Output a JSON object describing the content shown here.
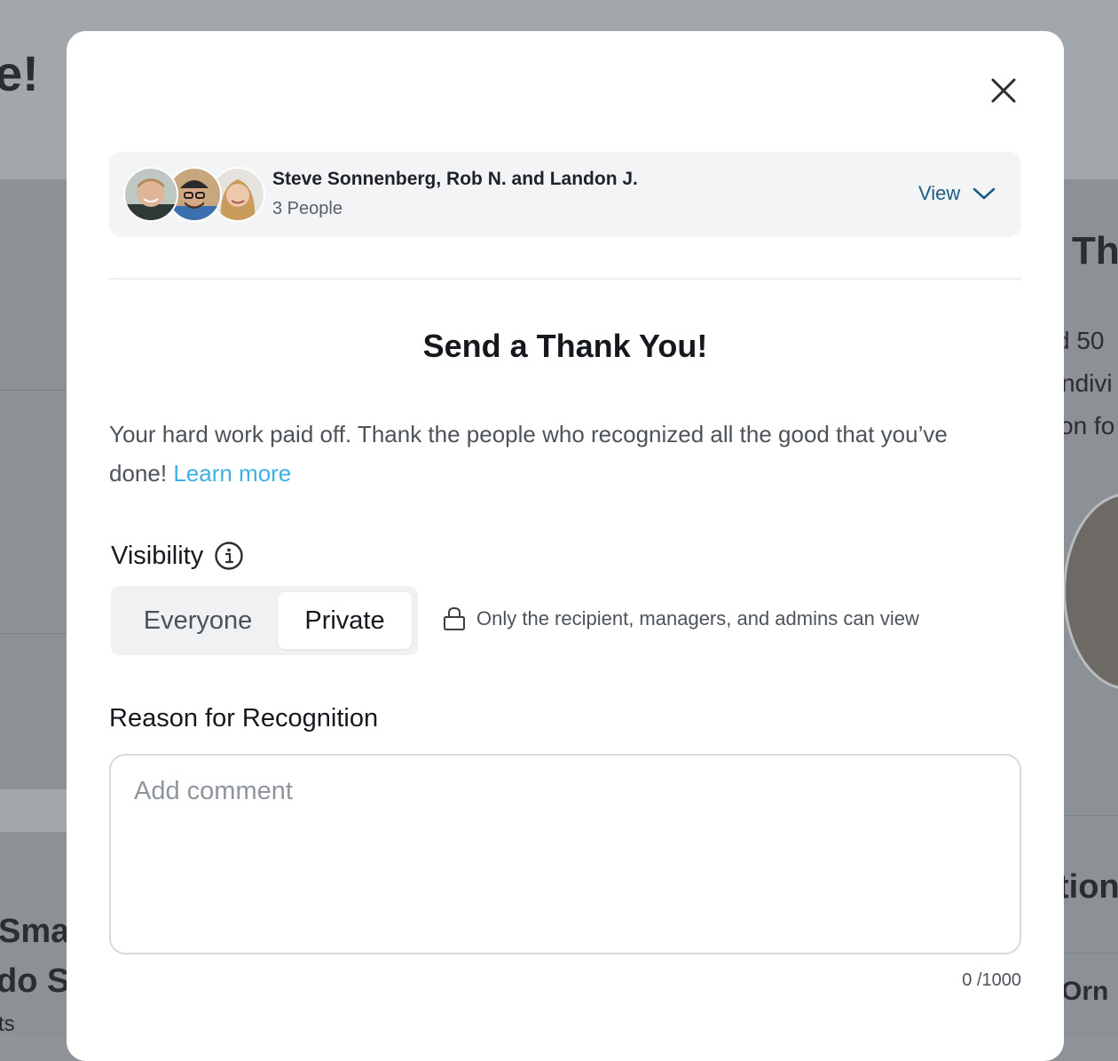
{
  "background": {
    "fragments": [
      "e!",
      "Th",
      "d 50",
      "ndivi",
      "on fo",
      "tion",
      "Orn",
      "Sma",
      "do S",
      "ts"
    ]
  },
  "modal": {
    "close_icon": "close-icon",
    "recipients": {
      "names": "Steve Sonnenberg, Rob N. and Landon J.",
      "count": "3 People",
      "view_label": "View",
      "view_icon": "chevron-down-icon"
    },
    "title": "Send a Thank You!",
    "description": "Your hard work paid off. Thank the people who recognized all the good that you’ve done!",
    "learn_more": "Learn more",
    "visibility": {
      "label": "Visibility",
      "info_icon": "info-icon",
      "options": [
        "Everyone",
        "Private"
      ],
      "selected": "Private",
      "note_icon": "lock-icon",
      "note": "Only the recipient, managers, and admins can view"
    },
    "reason": {
      "label": "Reason for Recognition",
      "placeholder": "Add comment",
      "value": "",
      "char_count": "0 /1000"
    }
  },
  "colors": {
    "accent_link": "#3fb0e6",
    "view_link": "#1d5e84",
    "overlay": "#8f9499"
  }
}
